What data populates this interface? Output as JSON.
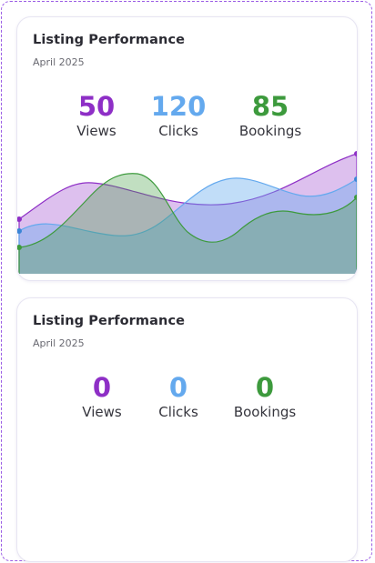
{
  "colors": {
    "views": "#8e2fc6",
    "clicks": "#64a9ee",
    "bookings": "#3d9a3d"
  },
  "cards": [
    {
      "title": "Listing Performance",
      "subtitle": "April 2025",
      "stats": [
        {
          "value": "50",
          "label": "Views"
        },
        {
          "value": "120",
          "label": "Clicks"
        },
        {
          "value": "85",
          "label": "Bookings"
        }
      ]
    },
    {
      "title": "Listing Performance",
      "subtitle": "April 2025",
      "stats": [
        {
          "value": "0",
          "label": "Views"
        },
        {
          "value": "0",
          "label": "Clicks"
        },
        {
          "value": "0",
          "label": "Bookings"
        }
      ]
    }
  ]
}
